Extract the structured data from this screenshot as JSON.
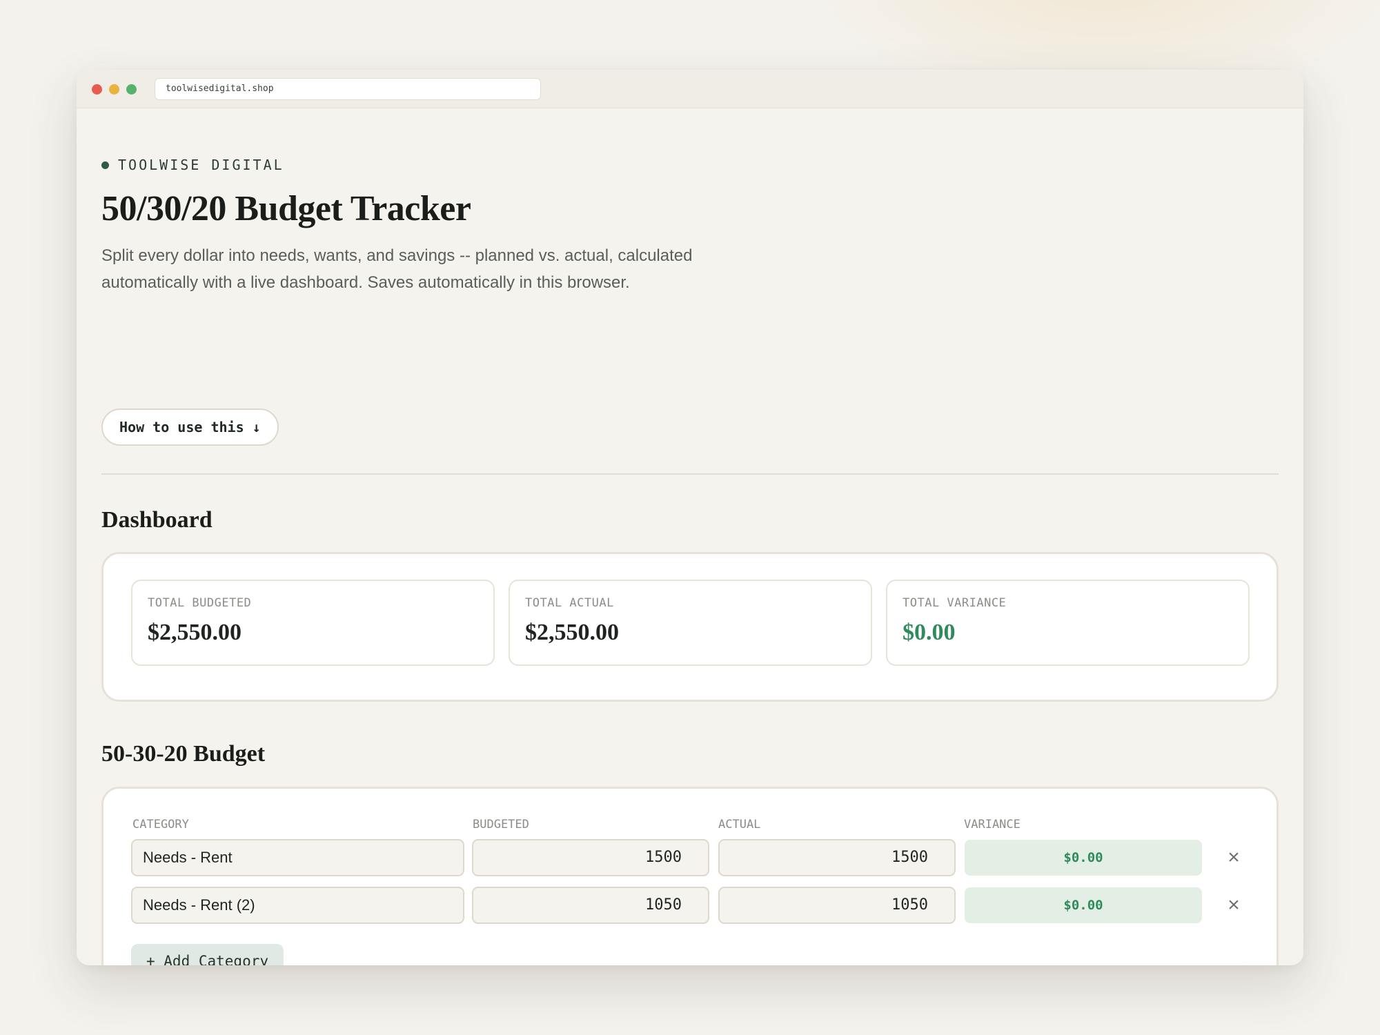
{
  "browser": {
    "url": "toolwisedigital.shop"
  },
  "brand": {
    "name": "TOOLWISE DIGITAL"
  },
  "header": {
    "title": "50/30/20 Budget Tracker",
    "description": "Split every dollar into needs, wants, and savings -- planned vs. actual, calculated automatically with a live dashboard. Saves automatically in this browser.",
    "howto_label": "How to use this ↓"
  },
  "dashboard": {
    "title": "Dashboard",
    "stats": [
      {
        "label": "TOTAL BUDGETED",
        "value": "$2,550.00"
      },
      {
        "label": "TOTAL ACTUAL",
        "value": "$2,550.00"
      },
      {
        "label": "TOTAL VARIANCE",
        "value": "$0.00"
      }
    ]
  },
  "budget": {
    "title": "50-30-20 Budget",
    "columns": [
      "CATEGORY",
      "BUDGETED",
      "ACTUAL",
      "VARIANCE"
    ],
    "rows": [
      {
        "category": "Needs - Rent",
        "budgeted": "1500",
        "actual": "1500",
        "variance": "$0.00"
      },
      {
        "category": "Needs - Rent (2)",
        "budgeted": "1050",
        "actual": "1050",
        "variance": "$0.00"
      }
    ],
    "remove_icon": "×",
    "add_label": "+ Add Category"
  },
  "colors": {
    "accent": "#2f5a47",
    "positive": "#2f8a5c",
    "background": "#f4f2ed"
  }
}
